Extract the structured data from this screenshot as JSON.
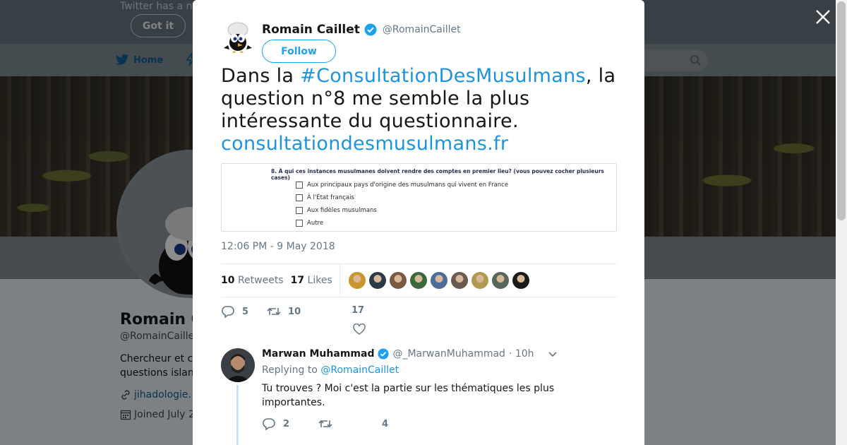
{
  "background": {
    "banner_text": "Twitter has a n",
    "got_it_label": "Got it",
    "nav_home_label": "Home",
    "profile_name": "Romain C",
    "profile_handle": "@RomainCaille",
    "profile_bio_line1": "Chercheur et c",
    "profile_bio_line2": "questions islan",
    "profile_link": "jihadologie.",
    "profile_joined": "Joined July 2"
  },
  "tweet": {
    "author_name": "Romain Caillet",
    "author_handle": "@RomainCaillet",
    "follow_label": "Follow",
    "text_before": "Dans la ",
    "hashtag": "#ConsultationDesMusulmans",
    "text_after": ", la question n°8 me semble la plus intéressante du questionnaire. ",
    "link": "consultationdesmusulmans.fr",
    "media": {
      "question": "8. À qui ces instances musulmanes doivent rendre des comptes en premier lieu? (vous pouvez cocher plusieurs cases)",
      "options": [
        "Aux principaux pays d'origine des musulmans qui vivent en France",
        "À l'État français",
        "Aux fidèles musulmans",
        "Autre"
      ]
    },
    "timestamp": "12:06 PM - 9 May 2018",
    "retweets_count": "10",
    "retweets_label": "Retweets",
    "likes_count": "17",
    "likes_label": "Likes",
    "actions": {
      "reply_count": "5",
      "retweet_count": "10",
      "like_count": "17"
    },
    "liker_colors": [
      "#c8962e",
      "#2b3a4a",
      "#7a5a40",
      "#3a6a3a",
      "#4a6d9a",
      "#6a5a50",
      "#b09a50",
      "#55685a",
      "#1a1a1a"
    ]
  },
  "reply": {
    "author_name": "Marwan Muhammad",
    "author_handle": "@_MarwanMuhammad",
    "time": "· 10h",
    "replying_prefix": "Replying to ",
    "replying_to": "@RomainCaillet",
    "text": "Tu trouves ? Moi c'est la partie sur les thématiques les plus importantes.",
    "reply_count": "2",
    "retweet_count": "",
    "like_count": "4"
  },
  "colors": {
    "brand": "#1da1f2",
    "link": "#1b95e0",
    "muted": "#657786"
  }
}
